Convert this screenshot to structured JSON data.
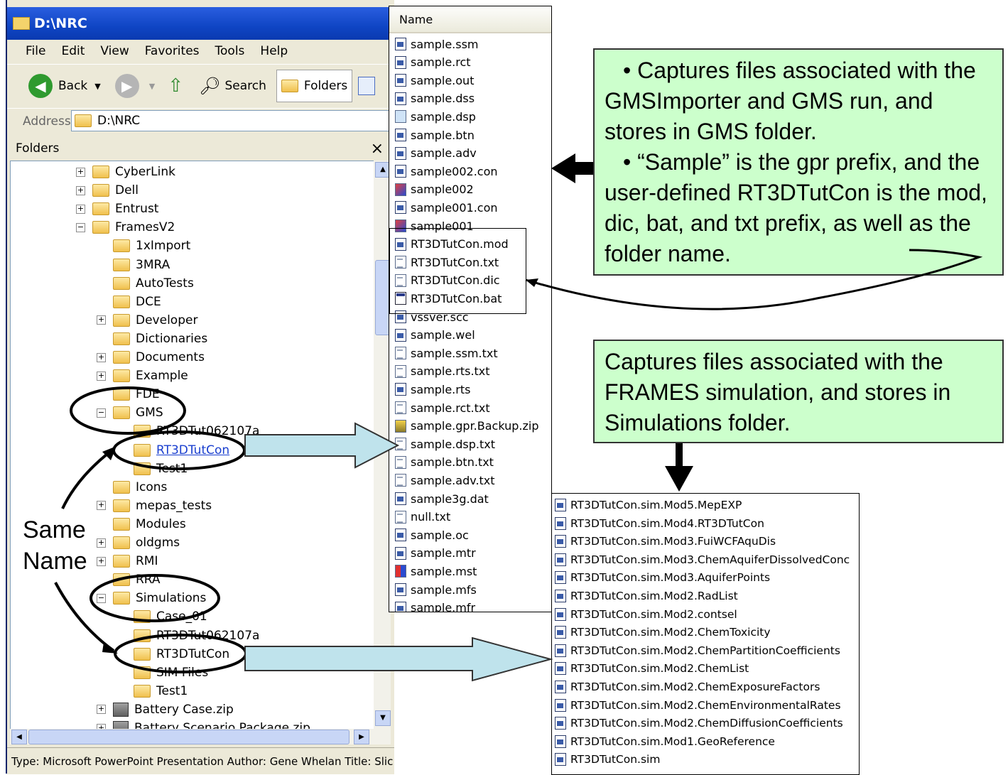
{
  "window": {
    "title": "D:\\NRC",
    "menu": [
      "File",
      "Edit",
      "View",
      "Favorites",
      "Tools",
      "Help"
    ],
    "toolbar": {
      "back": "Back",
      "search": "Search",
      "folders": "Folders"
    },
    "address_label": "Address",
    "address_value": "D:\\NRC",
    "folders_pane_title": "Folders",
    "close_glyph": "×",
    "statusbar": "Type: Microsoft PowerPoint Presentation Author: Gene Whelan Title: Slic"
  },
  "tree": [
    {
      "label": "CyberLink",
      "exp": "+"
    },
    {
      "label": "Dell",
      "exp": "+"
    },
    {
      "label": "Entrust",
      "exp": "+"
    },
    {
      "label": "FramesV2",
      "exp": "−"
    },
    {
      "label": "1xImport",
      "exp": ""
    },
    {
      "label": "3MRA",
      "exp": ""
    },
    {
      "label": "AutoTests",
      "exp": ""
    },
    {
      "label": "DCE",
      "exp": ""
    },
    {
      "label": "Developer",
      "exp": "+"
    },
    {
      "label": "Dictionaries",
      "exp": ""
    },
    {
      "label": "Documents",
      "exp": "+"
    },
    {
      "label": "Example",
      "exp": "+"
    },
    {
      "label": "FDE",
      "exp": ""
    },
    {
      "label": "GMS",
      "exp": "−"
    },
    {
      "label": "RT3DTut062107a",
      "exp": ""
    },
    {
      "label": "RT3DTutCon",
      "exp": ""
    },
    {
      "label": "Test1",
      "exp": ""
    },
    {
      "label": "Icons",
      "exp": ""
    },
    {
      "label": "mepas_tests",
      "exp": "+"
    },
    {
      "label": "Modules",
      "exp": ""
    },
    {
      "label": "oldgms",
      "exp": "+"
    },
    {
      "label": "RMI",
      "exp": "+"
    },
    {
      "label": "RRA",
      "exp": ""
    },
    {
      "label": "Simulations",
      "exp": "−"
    },
    {
      "label": "Case_01",
      "exp": ""
    },
    {
      "label": "RT3DTut062107a",
      "exp": ""
    },
    {
      "label": "RT3DTutCon",
      "exp": ""
    },
    {
      "label": "SIM Files",
      "exp": ""
    },
    {
      "label": "Test1",
      "exp": ""
    },
    {
      "label": "Battery Case.zip",
      "exp": "+"
    },
    {
      "label": "Battery Scenario Package.zip",
      "exp": "+"
    }
  ],
  "filelist": {
    "header": "Name",
    "files": [
      "sample.ssm",
      "sample.rct",
      "sample.out",
      "sample.dss",
      "sample.dsp",
      "sample.btn",
      "sample.adv",
      "sample002.con",
      "sample002",
      "sample001.con",
      "sample001",
      "RT3DTutCon.mod",
      "RT3DTutCon.txt",
      "RT3DTutCon.dic",
      "RT3DTutCon.bat",
      "vssver.scc",
      "sample.wel",
      "sample.ssm.txt",
      "sample.rts.txt",
      "sample.rts",
      "sample.rct.txt",
      "sample.gpr.Backup.zip",
      "sample.dsp.txt",
      "sample.btn.txt",
      "sample.adv.txt",
      "sample3g.dat",
      "null.txt",
      "sample.oc",
      "sample.mtr",
      "sample.mst",
      "sample.mfs",
      "sample.mfr"
    ]
  },
  "simfiles": [
    "RT3DTutCon.sim.Mod5.MepEXP",
    "RT3DTutCon.sim.Mod4.RT3DTutCon",
    "RT3DTutCon.sim.Mod3.FuiWCFAquDis",
    "RT3DTutCon.sim.Mod3.ChemAquiferDissolvedConc",
    "RT3DTutCon.sim.Mod3.AquiferPoints",
    "RT3DTutCon.sim.Mod2.RadList",
    "RT3DTutCon.sim.Mod2.contsel",
    "RT3DTutCon.sim.Mod2.ChemToxicity",
    "RT3DTutCon.sim.Mod2.ChemPartitionCoefficients",
    "RT3DTutCon.sim.Mod2.ChemList",
    "RT3DTutCon.sim.Mod2.ChemExposureFactors",
    "RT3DTutCon.sim.Mod2.ChemEnvironmentalRates",
    "RT3DTutCon.sim.Mod2.ChemDiffusionCoefficients",
    "RT3DTutCon.sim.Mod1.GeoReference",
    "RT3DTutCon.sim"
  ],
  "callouts": {
    "gms_line1": "• Captures files associated with the GMSImporter and GMS run, and stores in GMS folder.",
    "gms_line2": "• “Sample” is the gpr prefix, and the user-defined RT3DTutCon is the mod, dic, bat, and txt prefix, as well as the folder name.",
    "frames": "Captures files associated with the FRAMES simulation, and stores in Simulations folder.",
    "same_line1": "Same",
    "same_line2": "Name"
  },
  "colors": {
    "callout_bg": "#ccffcc",
    "arrow_fill": "#bfe3ec",
    "titlebar": "#0f45c4"
  }
}
